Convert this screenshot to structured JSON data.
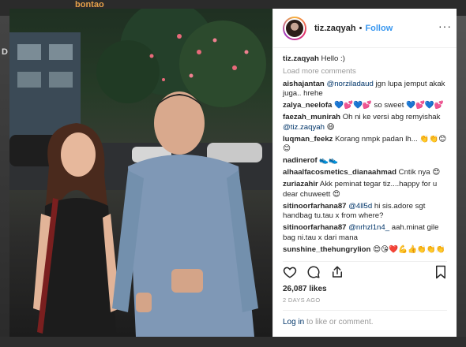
{
  "background": {
    "left_letter": "D",
    "brand_text": "bontao"
  },
  "post": {
    "username": "tiz.zaqyah",
    "separator": "•",
    "follow_label": "Follow",
    "caption_text": "Hello :)",
    "load_more": "Load more comments",
    "comments": [
      {
        "user": "aishajantan",
        "mention": "@norziladaud",
        "text": " jgn lupa jemput akak juga.. hrehe"
      },
      {
        "user": "zalya_neelofa",
        "mention": "",
        "text": " 💙💕💙💕 so sweet 💙💕💙💕"
      },
      {
        "user": "faezah_munirah",
        "mention": "",
        "text": " Oh ni ke versi abg remyishak "
      },
      {
        "user": "",
        "mention": "@tiz.zaqyah",
        "text": " 😄"
      },
      {
        "user": "luqman_feekz",
        "mention": "",
        "text": " Korang nmpk padan lh... 👏👏😊😊"
      },
      {
        "user": "nadinerof",
        "mention": "",
        "text": " 👟👟"
      },
      {
        "user": "alhaalfacosmetics_dianaahmad",
        "mention": "",
        "text": " Cntik nya 😍"
      },
      {
        "user": "zuriazahir",
        "mention": "",
        "text": " Akk peminat tegar tiz....happy for u dear chuweett 😍"
      },
      {
        "user": "sitinoorfarhana87",
        "mention": "@4ll5d",
        "text": " hi sis.adore sgt handbag tu.tau x from where?"
      },
      {
        "user": "sitinoorfarhana87",
        "mention": "@nrhzl1n4_",
        "text": " aah.minat gile bag ni.tau x dari mana"
      },
      {
        "user": "sunshine_thehungrylion",
        "mention": "",
        "text": " 😍😘❤️💪👍👏👏👏"
      }
    ],
    "likes": "26,087 likes",
    "date": "2 DAYS AGO",
    "login_link": "Log in",
    "login_rest": " to like or comment.",
    "more_menu": "···"
  },
  "icons": {
    "heart": "heart-icon",
    "comment": "comment-icon",
    "share": "share-icon",
    "bookmark": "bookmark-icon"
  }
}
